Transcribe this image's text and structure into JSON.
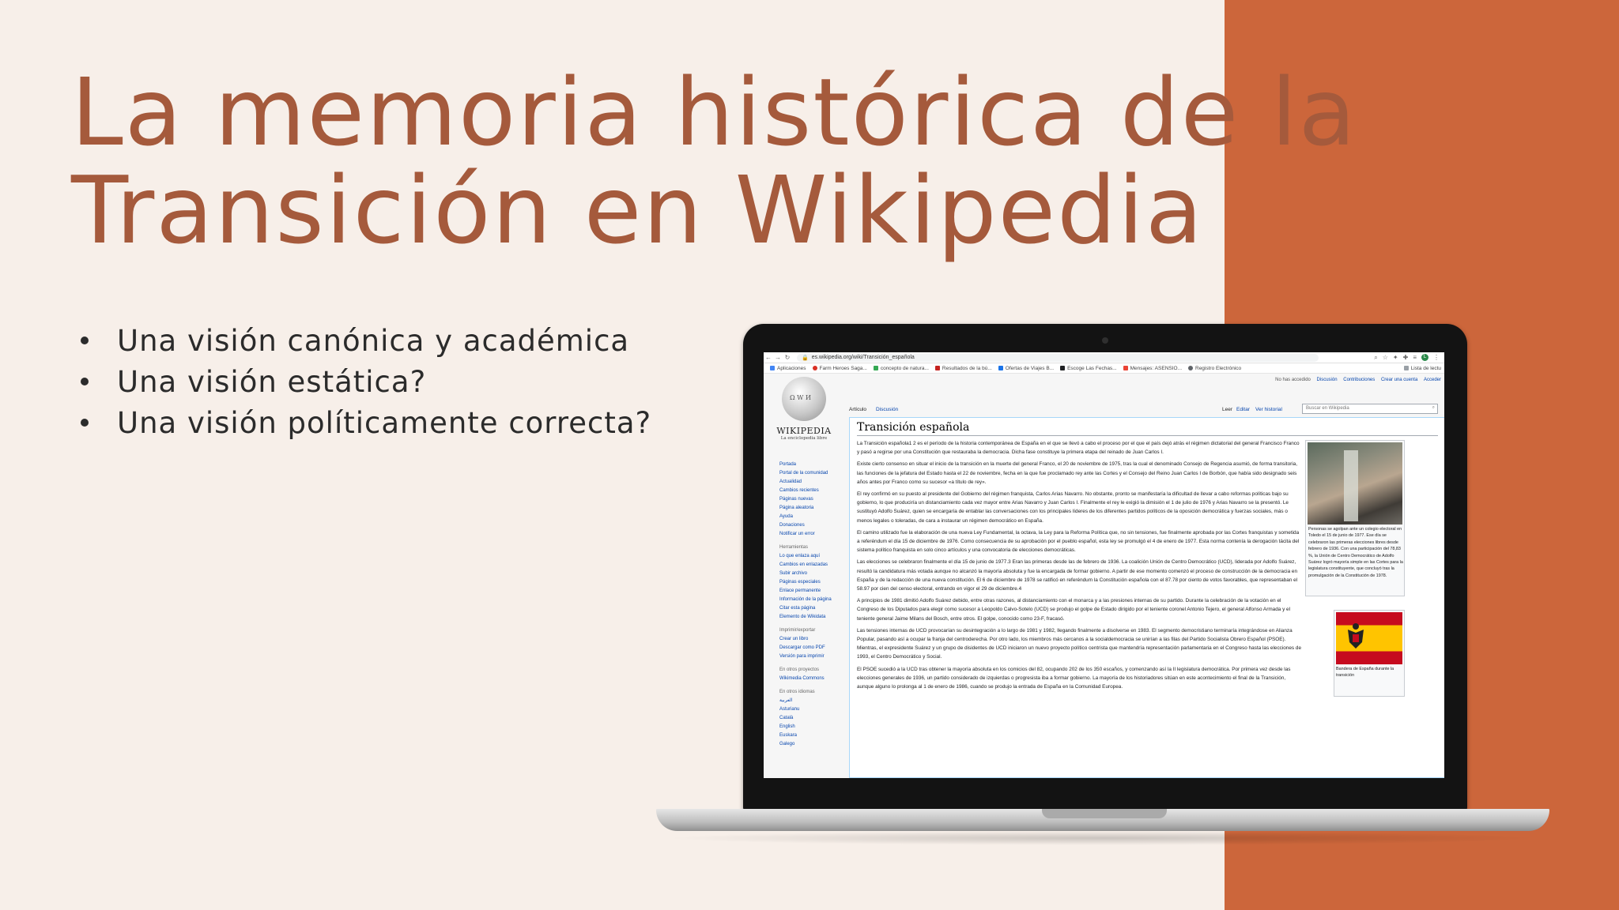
{
  "slide": {
    "title_line1": "La memoria histórica de la",
    "title_line2": "Transición en Wikipedia",
    "bullets": [
      "Una visión canónica y académica",
      "Una visión estática?",
      "Una visión políticamente correcta?"
    ],
    "colors": {
      "background": "#f7efe9",
      "accent_band": "#cc663b",
      "title": "#a55a3c"
    }
  },
  "browser": {
    "url": "es.wikipedia.org/wiki/Transición_española",
    "bookmarks": [
      "Aplicaciones",
      "Farm Heroes Saga...",
      "concepto de natura...",
      "Resultados de la bú...",
      "Ofertas de Viajes B...",
      "Escoge Las Fechas...",
      "Mensajes: ASENSIO...",
      "Registro Electrónico"
    ],
    "reading_list": "Lista de lectu",
    "avatar_letter": "L"
  },
  "wiki": {
    "personal": [
      "No has accedido",
      "Discusión",
      "Contribuciones",
      "Crear una cuenta",
      "Acceder"
    ],
    "logo_title": "WIKIPEDIA",
    "logo_sub": "La enciclopedia libre",
    "sidebar_main": [
      "Portada",
      "Portal de la comunidad",
      "Actualidad",
      "Cambios recientes",
      "Páginas nuevas",
      "Página aleatoria",
      "Ayuda",
      "Donaciones",
      "Notificar un error"
    ],
    "tools_head": "Herramientas",
    "sidebar_tools": [
      "Lo que enlaza aquí",
      "Cambios en enlazadas",
      "Subir archivo",
      "Páginas especiales",
      "Enlace permanente",
      "Información de la página",
      "Citar esta página",
      "Elemento de Wikidata"
    ],
    "print_head": "Imprimir/exportar",
    "sidebar_print": [
      "Crear un libro",
      "Descargar como PDF",
      "Versión para imprimir"
    ],
    "projects_head": "En otros proyectos",
    "sidebar_projects": [
      "Wikimedia Commons"
    ],
    "lang_head": "En otros idiomas",
    "sidebar_langs": [
      "العربية",
      "Asturianu",
      "Català",
      "English",
      "Euskara",
      "Galego"
    ],
    "tab_article": "Artículo",
    "tab_talk": "Discusión",
    "tab_read": "Leer",
    "tab_edit": "Editar",
    "tab_history": "Ver historial",
    "search_placeholder": "Buscar en Wikipedia",
    "heading": "Transición española",
    "paragraphs": [
      "La Transición española1 2 es el período de la historia contemporánea de España en el que se llevó a cabo el proceso por el que el país dejó atrás el régimen dictatorial del general Francisco Franco y pasó a regirse por una Constitución que restauraba la democracia. Dicha fase constituye la primera etapa del reinado de Juan Carlos I.",
      "Existe cierto consenso en situar el inicio de la transición en la muerte del general Franco, el 20 de noviembre de 1975, tras la cual el denominado Consejo de Regencia asumió, de forma transitoria, las funciones de la jefatura del Estado hasta el 22 de noviembre, fecha en la que fue proclamado rey ante las Cortes y el Consejo del Reino Juan Carlos I de Borbón, que había sido designado seis años antes por Franco como su sucesor «a título de rey».",
      "El rey confirmó en su puesto al presidente del Gobierno del régimen franquista, Carlos Arias Navarro. No obstante, pronto se manifestaría la dificultad de llevar a cabo reformas políticas bajo su gobierno, lo que produciría un distanciamiento cada vez mayor entre Arias Navarro y Juan Carlos I. Finalmente el rey le exigió la dimisión el 1 de julio de 1976 y Arias Navarro se la presentó. Le sustituyó Adolfo Suárez, quien se encargaría de entablar las conversaciones con los principales líderes de los diferentes partidos políticos de la oposición democrática y fuerzas sociales, más o menos legales o toleradas, de cara a instaurar un régimen democrático en España.",
      "El camino utilizado fue la elaboración de una nueva Ley Fundamental, la octava, la Ley para la Reforma Política que, no sin tensiones, fue finalmente aprobada por las Cortes franquistas y sometida a referéndum el día 15 de diciembre de 1976. Como consecuencia de su aprobación por el pueblo español, esta ley se promulgó el 4 de enero de 1977. Esta norma contenía la derogación tácita del sistema político franquista en solo cinco artículos y una convocatoria de elecciones democráticas.",
      "Las elecciones se celebraron finalmente el día 15 de junio de 1977.3 Eran las primeras desde las de febrero de 1936. La coalición Unión de Centro Democrático (UCD), liderada por Adolfo Suárez, resultó la candidatura más votada aunque no alcanzó la mayoría absoluta y fue la encargada de formar gobierno. A partir de ese momento comenzó el proceso de construcción de la democracia en España y de la redacción de una nueva constitución. El 6 de diciembre de 1978 se ratificó en referéndum la Constitución española con el 87.78 por ciento de votos favorables, que representaban el 58.97 por cien del censo electoral, entrando en vigor el 29 de diciembre.4",
      "A principios de 1981 dimitió Adolfo Suárez debido, entre otras razones, al distanciamiento con el monarca y a las presiones internas de su partido. Durante la celebración de la votación en el Congreso de los Diputados para elegir como sucesor a Leopoldo Calvo-Sotelo (UCD) se produjo el golpe de Estado dirigido por el teniente coronel Antonio Tejero, el general Alfonso Armada y el teniente general Jaime Milans del Bosch, entre otros. El golpe, conocido como 23-F, fracasó.",
      "Las tensiones internas de UCD provocarían su desintegración a lo largo de 1981 y 1982, llegando finalmente a disolverse en 1983. El segmento democristiano terminaría integrándose en Alianza Popular, pasando así a ocupar la franja del centroderecha. Por otro lado, los miembros más cercanos a la socialdemocracia se unirían a las filas del Partido Socialista Obrero Español (PSOE). Mientras, el expresidente Suárez y un grupo de disidentes de UCD iniciaron un nuevo proyecto político centrista que mantendría representación parlamentaria en el Congreso hasta las elecciones de 1993, el Centro Democrático y Social.",
      "El PSOE sucedió a la UCD tras obtener la mayoría absoluta en los comicios del 82, ocupando 202 de los 350 escaños, y comenzando así la II legislatura democrática. Por primera vez desde las elecciones generales de 1936, un partido considerado de izquierdas o progresista iba a formar gobierno. La mayoría de los historiadores sitúan en este acontecimiento el final de la Transición, aunque alguno lo prolonga al 1 de enero de 1986, cuando se produjo la entrada de España en la Comunidad Europea."
    ],
    "photo_caption": "Personas se agolpan ante un colegio electoral en Toledo el 15 de junio de 1977. Ese día se celebraron las primeras elecciones libres desde febrero de 1936. Con una participación del 78,83 %, la Unión de Centro Democrático de Adolfo Suárez logró mayoría simple en las Cortes para la legislatura constituyente, que concluyó tras la promulgación de la Constitución de 1978.",
    "flag_caption": "Bandera de España durante la transición"
  }
}
